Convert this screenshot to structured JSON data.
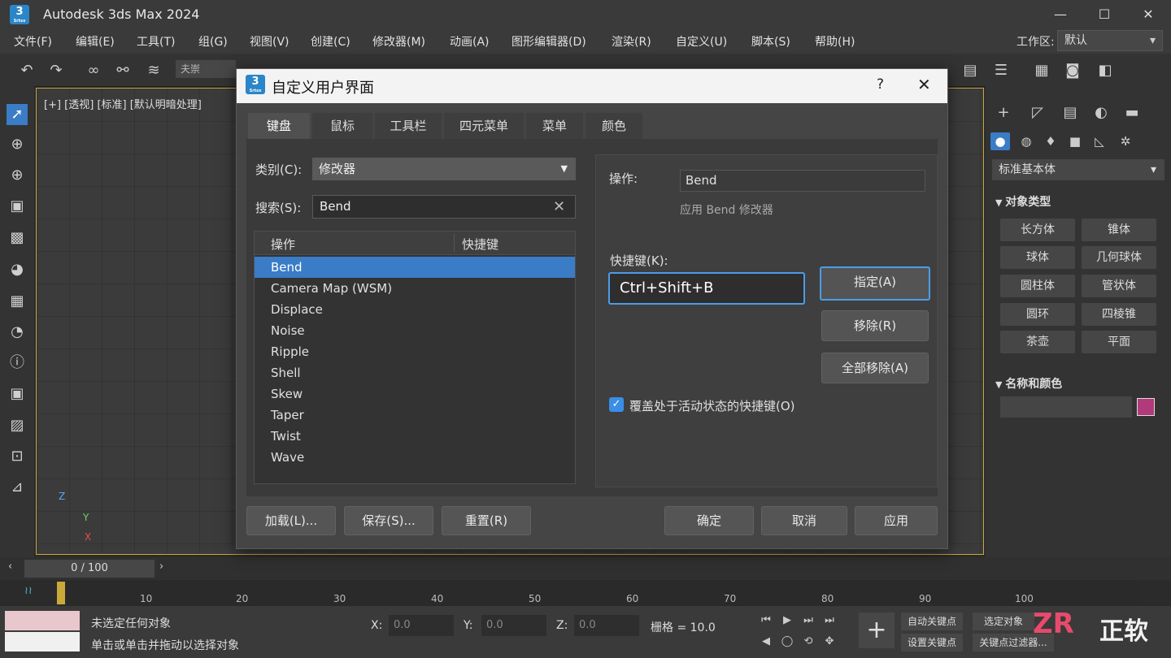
{
  "app": {
    "title": "Autodesk 3ds Max 2024",
    "icon_digit": "3",
    "icon_sub": "Srtsx"
  },
  "menu": [
    "文件(F)",
    "编辑(E)",
    "工具(T)",
    "组(G)",
    "视图(V)",
    "创建(C)",
    "修改器(M)",
    "动画(A)",
    "图形编辑器(D)",
    "渲染(R)",
    "自定义(U)",
    "脚本(S)",
    "帮助(H)"
  ],
  "workspace": {
    "label": "工作区:",
    "value": "默认"
  },
  "toolbar": {
    "selection_set": "夫崇"
  },
  "viewport": {
    "label": "[+] [透视] [标准] [默认明暗处理]",
    "axis_x": "X",
    "axis_y": "Y",
    "axis_z": "Z"
  },
  "command_panel": {
    "dropdown": "标准基本体",
    "rollout_object_type": "对象类型",
    "objects": [
      "长方体",
      "锥体",
      "球体",
      "几何球体",
      "圆柱体",
      "管状体",
      "圆环",
      "四棱锥",
      "茶壶",
      "平面"
    ],
    "rollout_name_color": "名称和颜色",
    "swatch_color": "#b03a7a"
  },
  "dialog": {
    "title": "自定义用户界面",
    "help": "?",
    "close": "✕",
    "tabs": [
      "键盘",
      "鼠标",
      "工具栏",
      "四元菜单",
      "菜单",
      "颜色"
    ],
    "category_label": "类别(C):",
    "category_value": "修改器",
    "search_label": "搜索(S):",
    "search_value": "Bend",
    "list_header_action": "操作",
    "list_header_hotkey": "快捷键",
    "actions": [
      "Bend",
      "Camera Map (WSM)",
      "Displace",
      "Noise",
      "Ripple",
      "Shell",
      "Skew",
      "Taper",
      "Twist",
      "Wave"
    ],
    "operation_label": "操作:",
    "operation_value": "Bend",
    "operation_desc": "应用 Bend 修改器",
    "hotkey_label": "快捷键(K):",
    "hotkey_value": "Ctrl+Shift+B",
    "assign": "指定(A)",
    "remove": "移除(R)",
    "remove_all": "全部移除(A)",
    "override_label": "覆盖处于活动状态的快捷键(O)",
    "load": "加载(L)...",
    "save": "保存(S)...",
    "reset": "重置(R)",
    "ok": "确定",
    "cancel": "取消",
    "apply": "应用"
  },
  "timeline": {
    "slider": "0 / 100",
    "ticks": [
      "10",
      "20",
      "30",
      "40",
      "50",
      "60",
      "70",
      "80",
      "90",
      "100"
    ]
  },
  "status": {
    "line1": "未选定任何对象",
    "line2": "单击或单击并拖动以选择对象",
    "x_label": "X:",
    "x_value": "0.0",
    "y_label": "Y:",
    "y_value": "0.0",
    "z_label": "Z:",
    "z_value": "0.0",
    "grid": "栅格 = 10.0",
    "auto_key": "自动关键点",
    "set_key": "设置关键点",
    "selected": "选定对象",
    "key_filter": "关键点过滤器..."
  },
  "watermark": {
    "logo": "ZR",
    "text": "正软"
  }
}
